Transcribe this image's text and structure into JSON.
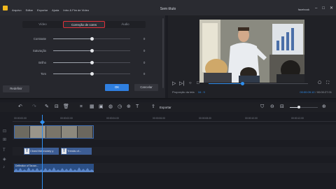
{
  "app": {
    "title": "Sem título",
    "menu": [
      "Arquivo",
      "Editar",
      "Exportar",
      "Ajuda",
      "Intro & Fim de Vídeo"
    ],
    "right_label": "facebook",
    "sub_right": "Salvos Recentes 14:46"
  },
  "panel": {
    "tabs": [
      {
        "label": "Vídeo",
        "active": false
      },
      {
        "label": "Correção de cores",
        "active": true
      },
      {
        "label": "Áudio",
        "active": false
      }
    ],
    "sliders": [
      {
        "label": "Contraste",
        "value": "0",
        "level": 0.5
      },
      {
        "label": "Saturação",
        "value": "0",
        "level": 0.5
      },
      {
        "label": "Brilho",
        "value": "0",
        "level": 0.5
      },
      {
        "label": "Tom",
        "value": "0",
        "level": 0.5
      }
    ],
    "reset_label": "Redefinir",
    "ok_label": "OK",
    "cancel_label": "Cancelar"
  },
  "preview": {
    "aspect_label": "Proporção da tela",
    "aspect_value": "16 : 9",
    "time_current": "00:00:09.12",
    "time_total": "00:00:27.01",
    "progress": 0.34
  },
  "toolbar": {
    "export_label": "Exportar",
    "zoom_level": 0.32
  },
  "timeline": {
    "ruler": [
      "00:00:00.00",
      "00:00:02.00",
      "00:00:04.00",
      "00:00:06.00",
      "00:00:08.00",
      "00:00:10.00",
      "00:00:12.00",
      "00:00:14.00"
    ],
    "text_clips": [
      "I lived the money y",
      "Trends of..."
    ],
    "audio_label": "Deflection of Tarzan..."
  },
  "colors": {
    "accent": "#2f7fe0",
    "active_tab_border": "#e0313a",
    "clip_text": "#3d5d94",
    "clip_audio": "#2b4f86"
  }
}
